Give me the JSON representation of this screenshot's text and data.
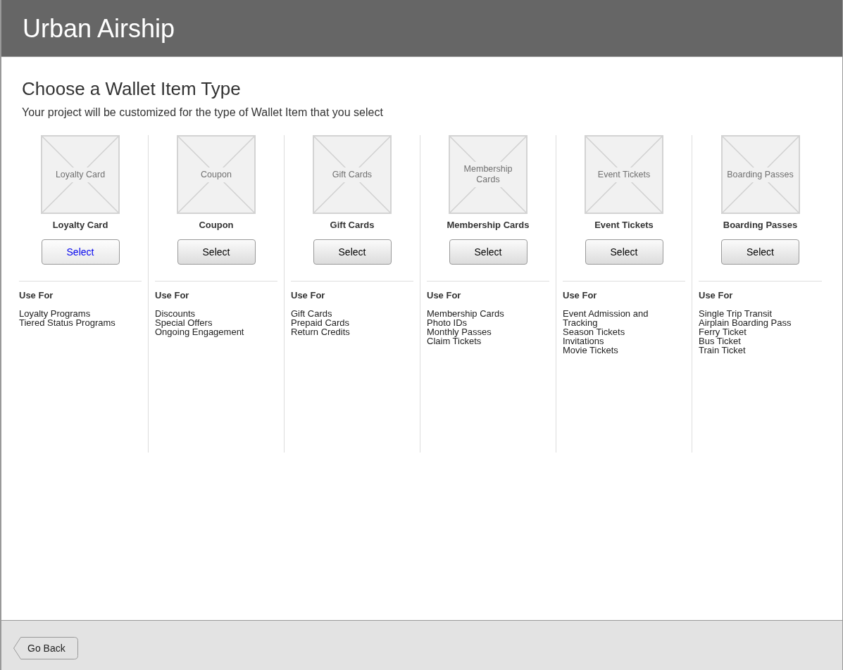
{
  "header": {
    "title": "Urban Airship"
  },
  "page": {
    "heading": "Choose a Wallet Item Type",
    "subtitle": "Your project will be customized for the type of Wallet Item that you select"
  },
  "item_types": [
    {
      "image_label": "Loyalty Card",
      "name": "Loyalty Card",
      "button": "Select",
      "selected": true,
      "use_for_label": "Use For",
      "uses": [
        "Loyalty Programs",
        "Tiered Status Programs"
      ]
    },
    {
      "image_label": "Coupon",
      "name": "Coupon",
      "button": "Select",
      "selected": false,
      "use_for_label": "Use For",
      "uses": [
        "Discounts",
        "Special Offers",
        "Ongoing Engagement"
      ]
    },
    {
      "image_label": "Gift Cards",
      "name": "Gift Cards",
      "button": "Select",
      "selected": false,
      "use_for_label": "Use For",
      "uses": [
        "Gift Cards",
        "Prepaid Cards",
        "Return Credits"
      ]
    },
    {
      "image_label": "Membership Cards",
      "name": "Membership Cards",
      "button": "Select",
      "selected": false,
      "use_for_label": "Use For",
      "uses": [
        "Membership Cards",
        "Photo IDs",
        "Monthly Passes",
        "Claim Tickets"
      ]
    },
    {
      "image_label": "Event Tickets",
      "name": "Event Tickets",
      "button": "Select",
      "selected": false,
      "use_for_label": "Use For",
      "uses": [
        "Event Admission and Tracking",
        "Season Tickets",
        "Invitations",
        "Movie Tickets"
      ]
    },
    {
      "image_label": "Boarding Passes",
      "name": "Boarding Passes",
      "button": "Select",
      "selected": false,
      "use_for_label": "Use For",
      "uses": [
        "Single Trip Transit",
        "Airplain Boarding Pass",
        "Ferry Ticket",
        "Bus Ticket",
        "Train Ticket"
      ]
    }
  ],
  "footer": {
    "back_button": "Go Back"
  }
}
